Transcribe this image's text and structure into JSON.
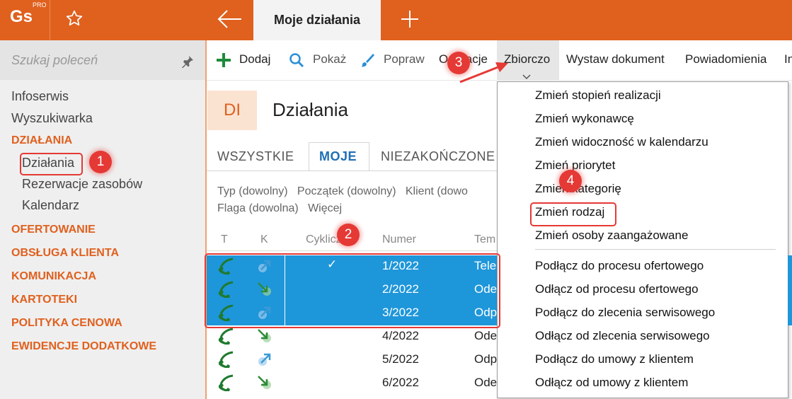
{
  "app": {
    "logo_text": "Gs",
    "logo_sup": "PRO",
    "active_tab": "Moje działania"
  },
  "search": {
    "placeholder": "Szukaj poleceń"
  },
  "sidebar": {
    "items": [
      "Infoserwis",
      "Wyszukiwarka"
    ],
    "group_active": "DZIAŁANIA",
    "subitems": [
      "Działania",
      "Rezerwacje zasobów",
      "Kalendarz"
    ],
    "groups": [
      "OFERTOWANIE",
      "OBSŁUGA KLIENTA",
      "KOMUNIKACJA",
      "KARTOTEKI",
      "POLITYKA CENOWA",
      "EWIDENCJE DODATKOWE"
    ]
  },
  "toolbar": {
    "add": "Dodaj",
    "show": "Pokaż",
    "edit": "Popraw",
    "ops": "Operacje",
    "bulk": "Zbiorczo",
    "issue": "Wystaw dokument",
    "notif": "Powiadomienia",
    "more": "In"
  },
  "header": {
    "tile": "DI",
    "title": "Działania"
  },
  "tabs": [
    "WSZYSTKIE",
    "MOJE",
    "NIEZAKOŃCZONE"
  ],
  "filters": {
    "line1": "Typ (dowolny)   Początek (dowolny)   Klient (dowo",
    "line2": "Flaga (dowolna)   Więcej"
  },
  "columns": {
    "t": "T",
    "k": "K",
    "cyclic": "Cykliczn",
    "number": "Numer",
    "topic": "Tem"
  },
  "rows": [
    {
      "number": "1/2022",
      "topic": "Tele",
      "check": "✓",
      "selected": true
    },
    {
      "number": "2/2022",
      "topic": "Ode",
      "check": "",
      "selected": true
    },
    {
      "number": "3/2022",
      "topic": "Odp",
      "check": "",
      "selected": true
    },
    {
      "number": "4/2022",
      "topic": "Ode",
      "check": "",
      "selected": false
    },
    {
      "number": "5/2022",
      "topic": "Odp",
      "check": "",
      "selected": false
    },
    {
      "number": "6/2022",
      "topic": "Ode",
      "check": "",
      "selected": false
    }
  ],
  "menu": {
    "items": [
      "Zmień stopień realizacji",
      "Zmień wykonawcę",
      "Zmień widoczność w kalendarzu",
      "Zmień priorytet",
      "Zmień kategorię",
      "Zmień rodzaj",
      "Zmień osoby zaangażowane",
      "Podłącz do procesu ofertowego",
      "Odłącz od procesu ofertowego",
      "Podłącz do zlecenia serwisowego",
      "Odłącz od zlecenia serwisowego",
      "Podłącz do umowy z klientem",
      "Odłącz od umowy z klientem"
    ]
  },
  "badges": [
    "1",
    "2",
    "3",
    "4"
  ],
  "colors": {
    "accent": "#E0601E",
    "selection": "#1E96DA",
    "annotation": "#E53935"
  }
}
